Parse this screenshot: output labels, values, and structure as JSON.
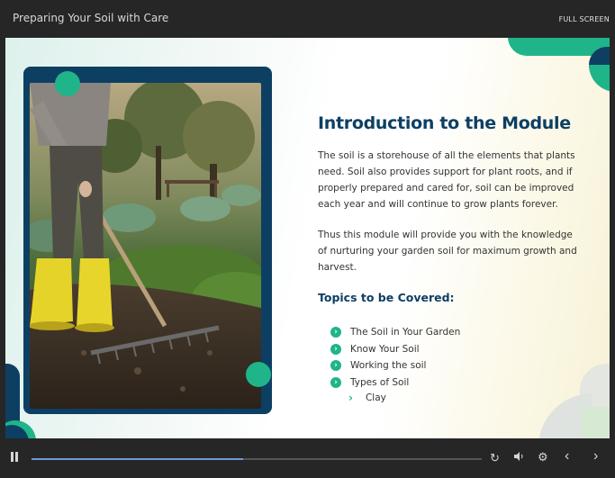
{
  "header": {
    "course_title": "Preparing Your Soil with Care",
    "fullscreen_label": "FULL SCREEN"
  },
  "slide": {
    "heading": "Introduction to the Module",
    "paragraph1": "The soil is a storehouse of all the elements that plants need. Soil also provides support for plant roots, and if properly prepared and cared for, soil can be improved each year and will continue to grow plants forever.",
    "paragraph2": "Thus this module will provide you with the knowledge of nurturing your garden soil for maximum growth and harvest.",
    "topics_heading": "Topics to be Covered:",
    "topics": [
      {
        "label": "The Soil in Your Garden"
      },
      {
        "label": "Know Your Soil"
      },
      {
        "label": "Working the soil"
      },
      {
        "label": "Types of Soil"
      }
    ],
    "subtopic": "Clay"
  },
  "player": {
    "progress_fraction": 0.47
  },
  "colors": {
    "accent_green": "#1fb489",
    "navy": "#0d3f63",
    "bar_bg": "#262626"
  }
}
